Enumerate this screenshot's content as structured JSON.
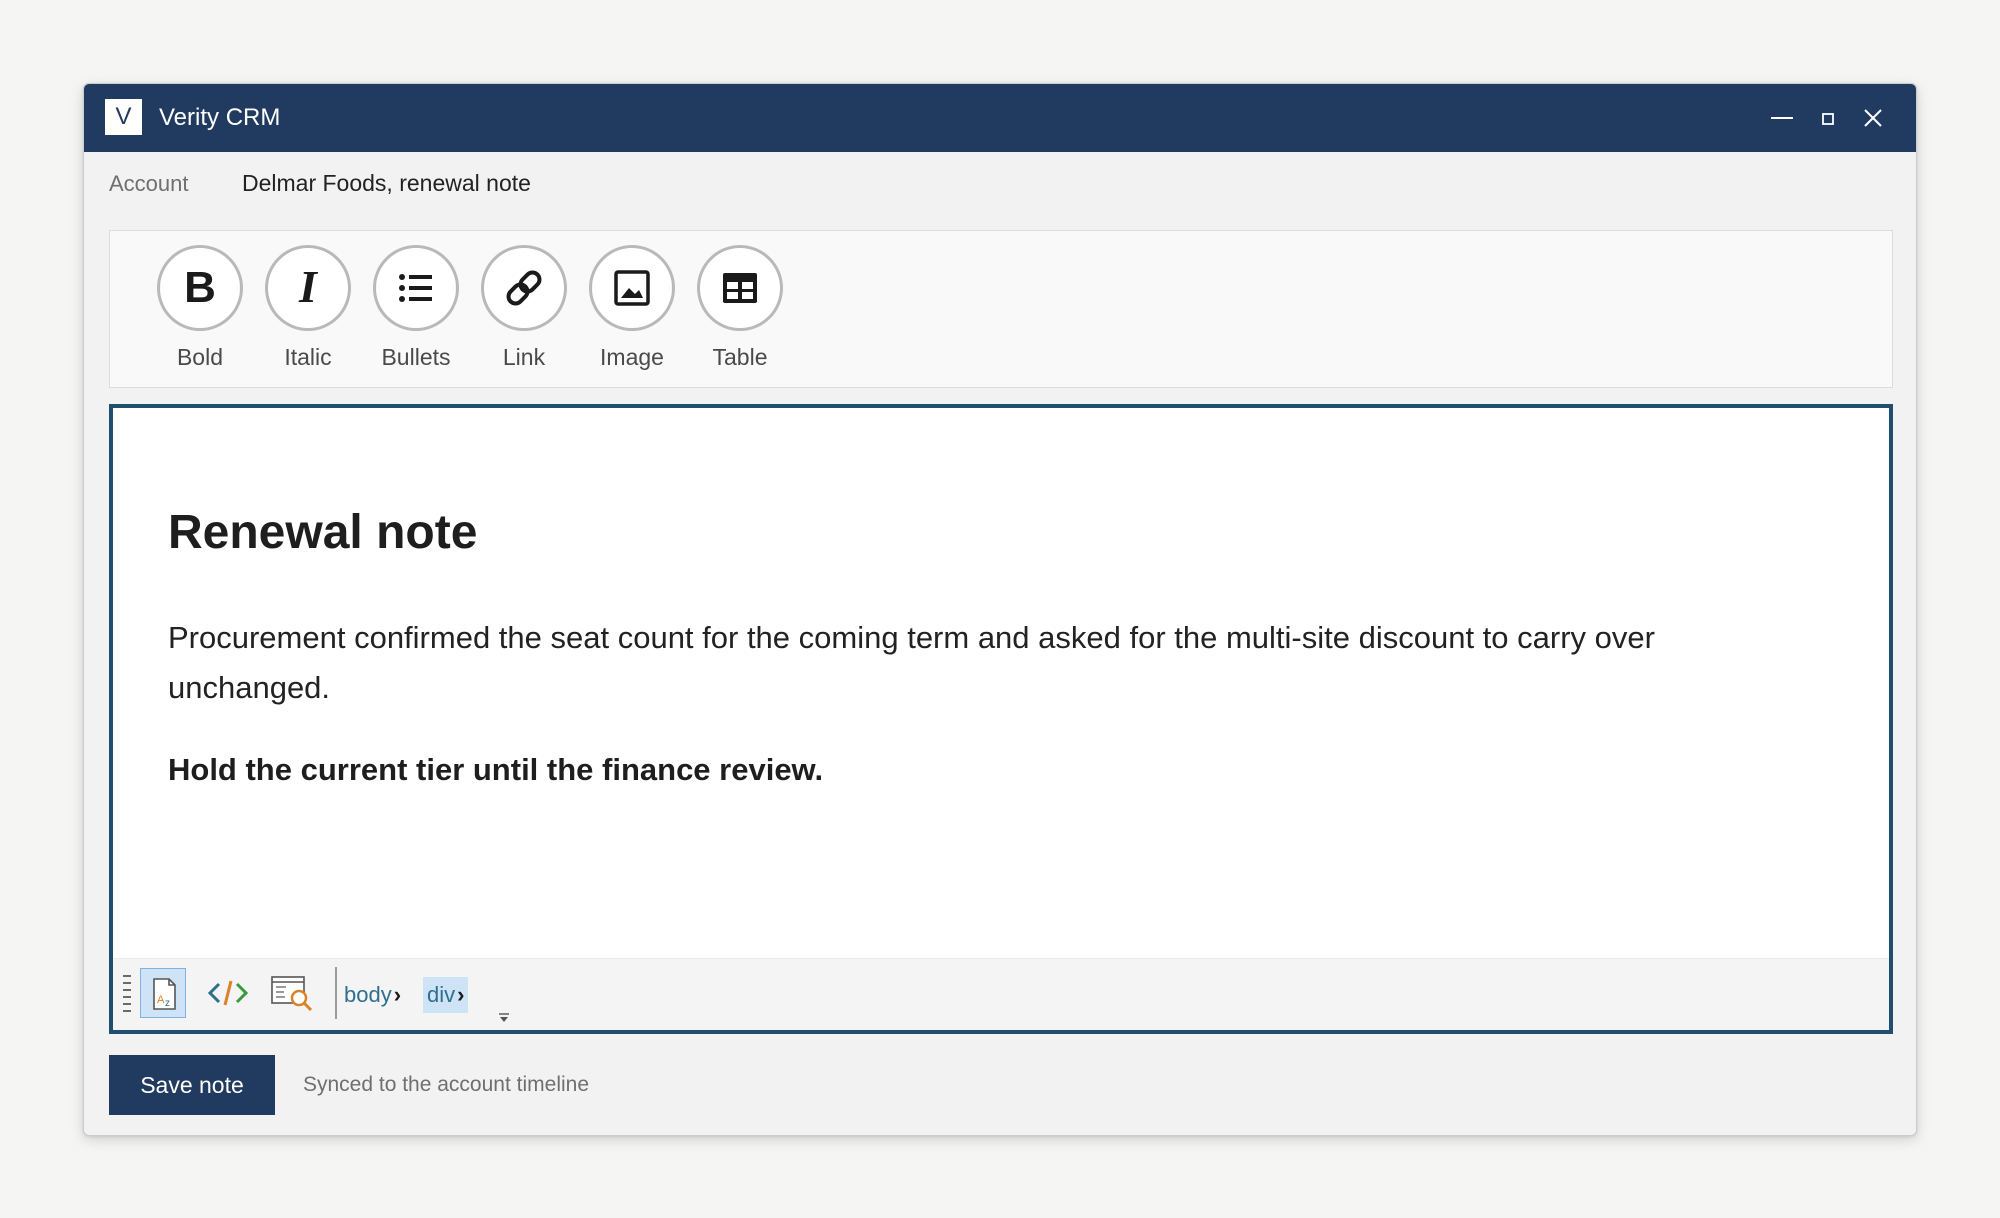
{
  "window": {
    "logo_letter": "V",
    "title": "Verity CRM"
  },
  "account": {
    "label": "Account",
    "value": "Delmar Foods, renewal note"
  },
  "toolbar": {
    "tools": [
      {
        "label": "Bold",
        "icon": "bold-icon"
      },
      {
        "label": "Italic",
        "icon": "italic-icon"
      },
      {
        "label": "Bullets",
        "icon": "bullets-icon"
      },
      {
        "label": "Link",
        "icon": "link-icon"
      },
      {
        "label": "Image",
        "icon": "image-icon"
      },
      {
        "label": "Table",
        "icon": "table-icon"
      }
    ]
  },
  "editor": {
    "heading": "Renewal note",
    "paragraph": "Procurement confirmed the seat count for the coming term and asked for the multi-site discount to carry over unchanged.",
    "strong": "Hold the current tier until the finance review.",
    "breadcrumbs": [
      "body",
      "div"
    ],
    "active_mode": "design"
  },
  "footer": {
    "save_label": "Save note",
    "status": "Synced to the account timeline"
  },
  "colors": {
    "titlebar": "#213b60",
    "editor_border": "#1f4e6e",
    "save_button": "#213b60"
  }
}
